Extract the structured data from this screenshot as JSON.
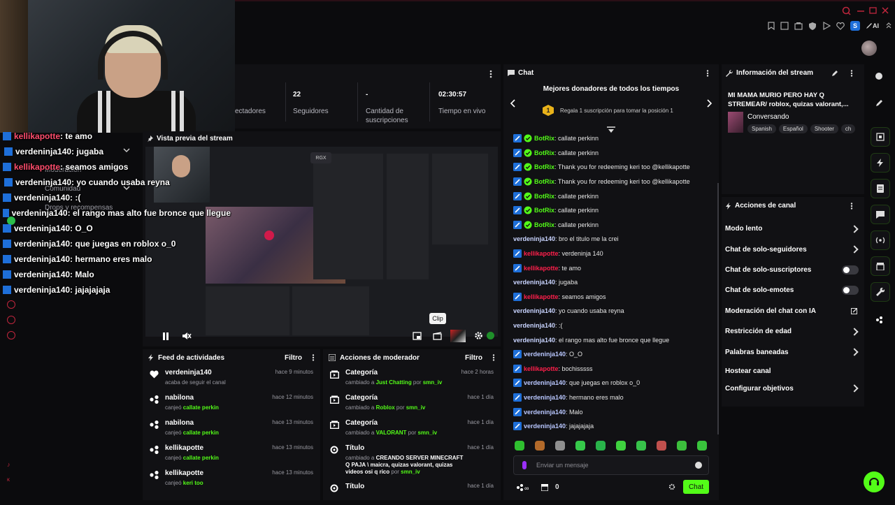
{
  "colors": {
    "accent": "#53fc18",
    "bg": "#0b0b0d",
    "panel": "#111114",
    "mod_badge": "#1e6fd9",
    "red_user": "#ff4d6d"
  },
  "topbar": {
    "ai_label": "AI",
    "avatar_letter": "S"
  },
  "stats": {
    "viewers_label": "ectadores",
    "followers_value": "22",
    "followers_label": "Seguidores",
    "subs_value": "-",
    "subs_label": "Cantidad de suscripciones",
    "uptime_value": "02:30:57",
    "uptime_label": "Tiempo en vivo"
  },
  "preview": {
    "title": "Vista previa del stream",
    "clip_tooltip": "Clip"
  },
  "sidebar_ghost": [
    "Moderación",
    "Comunidad",
    "Drops y recompensas"
  ],
  "overlay_chat": [
    {
      "user": "kellikapotte",
      "text": " : te amo",
      "color": "red"
    },
    {
      "user": "verdeninja140",
      "text": " : jugaba",
      "color": "white"
    },
    {
      "user": "kellikapotte",
      "text": " : seamos amigos",
      "color": "red"
    },
    {
      "user": "verdeninja140",
      "text": " : yo cuando usaba reyna",
      "color": "white"
    },
    {
      "user": "verdeninja140",
      "text": " : :(",
      "color": "white"
    },
    {
      "user": "verdeninja140",
      "text": " : el rango mas alto fue bronce que llegue",
      "color": "white"
    },
    {
      "user": "verdeninja140",
      "text": " : O_O",
      "color": "white"
    },
    {
      "user": "verdeninja140",
      "text": " : que juegas en roblox o_0",
      "color": "white"
    },
    {
      "user": "verdeninja140",
      "text": " : hermano eres malo",
      "color": "white"
    },
    {
      "user": "verdeninja140",
      "text": " : Malo",
      "color": "white"
    },
    {
      "user": "verdeninja140",
      "text": " : jajajajaja",
      "color": "white"
    }
  ],
  "feed": {
    "title": "Feed de actividades",
    "filter": "Filtro",
    "items": [
      {
        "user": "verdeninja140",
        "desc": "acaba de seguir el canal",
        "highlight": "",
        "time": "hace 9 minutos",
        "icon": "heart-icon"
      },
      {
        "user": "nabilona",
        "desc": "canjeó ",
        "highlight": "callate perkin",
        "time": "hace 12 minutos",
        "icon": "reward-icon"
      },
      {
        "user": "nabilona",
        "desc": "canjeó ",
        "highlight": "callate perkin",
        "time": "hace 13 minutos",
        "icon": "reward-icon"
      },
      {
        "user": "kellikapotte",
        "desc": "canjeó ",
        "highlight": "callate perkin",
        "time": "hace 13 minutos",
        "icon": "reward-icon"
      },
      {
        "user": "kellikapotte",
        "desc": "canjeó ",
        "highlight": "keri too",
        "time": "hace 13 minutos",
        "icon": "reward-icon"
      }
    ]
  },
  "modactions": {
    "title": "Acciones de moderador",
    "filter": "Filtro",
    "items": [
      {
        "title": "Categoría",
        "pre": "cambiado a ",
        "value": "Just Chatting",
        "mid": " por ",
        "by": "smn_iv",
        "time": "hace 2 horas"
      },
      {
        "title": "Categoría",
        "pre": "cambiado a ",
        "value": "Roblox",
        "mid": " por ",
        "by": "smn_iv",
        "time": "hace 1 día"
      },
      {
        "title": "Categoría",
        "pre": "cambiado a ",
        "value": "VALORANT",
        "mid": " por ",
        "by": "smn_iv",
        "time": "hace 1 día"
      },
      {
        "title": "Título",
        "pre": "cambiado a ",
        "value": "CREANDO SERVER MINECRAFT Q PAJA \\ maicra, quizas valorant, quizas videos osi q rico",
        "mid": " por ",
        "by": "smn_iv",
        "time": "hace 1 día"
      },
      {
        "title": "Título",
        "pre": "",
        "value": "",
        "mid": "",
        "by": "",
        "time": "hace 1 día"
      }
    ]
  },
  "chat": {
    "title": "Chat",
    "donors_title": "Mejores donadores de todos los tiempos",
    "donors_rank": "1",
    "donors_text": "Regala 1 suscripción para tomar la posición 1",
    "messages": [
      {
        "user": "BotRix",
        "text": ": callate perkinn",
        "style": "bot"
      },
      {
        "user": "BotRix",
        "text": ": callate perkinn",
        "style": "bot"
      },
      {
        "user": "BotRix",
        "text": ": Thank you for redeeming keri too @kellikapotte",
        "style": "bot"
      },
      {
        "user": "BotRix",
        "text": ": Thank you for redeeming keri too @kellikapotte",
        "style": "bot"
      },
      {
        "user": "BotRix",
        "text": ": callate perkinn",
        "style": "bot"
      },
      {
        "user": "BotRix",
        "text": ": callate perkinn",
        "style": "bot"
      },
      {
        "user": "BotRix",
        "text": ": callate perkinn",
        "style": "bot"
      },
      {
        "user": "verdeninja140",
        "text": ": bro el titulo me la crei",
        "style": "plain"
      },
      {
        "user": "kellikapotte",
        "text": ": verdeninja 140",
        "style": "red"
      },
      {
        "user": "kellikapotte",
        "text": ": te amo",
        "style": "red"
      },
      {
        "user": "verdeninja140",
        "text": ": jugaba",
        "style": "plain"
      },
      {
        "user": "kellikapotte",
        "text": ": seamos amigos",
        "style": "red"
      },
      {
        "user": "verdeninja140",
        "text": ": yo cuando usaba reyna",
        "style": "plain"
      },
      {
        "user": "verdeninja140",
        "text": ": :(",
        "style": "plain"
      },
      {
        "user": "verdeninja140",
        "text": ": el rango mas alto fue bronce que llegue",
        "style": "plain"
      },
      {
        "user": "verdeninja140",
        "text": ": O_O",
        "style": "mod"
      },
      {
        "user": "kellikapotte",
        "text": ": bochisssss",
        "style": "red"
      },
      {
        "user": "verdeninja140",
        "text": ": que juegas en roblox o_0",
        "style": "mod"
      },
      {
        "user": "verdeninja140",
        "text": ": hermano eres malo",
        "style": "mod"
      },
      {
        "user": "verdeninja140",
        "text": ": Malo",
        "style": "mod"
      },
      {
        "user": "verdeninja140",
        "text": ": jajajajaja",
        "style": "mod"
      }
    ],
    "input_placeholder": "Enviar un mensaje",
    "points": "0",
    "send_label": "Chat"
  },
  "info": {
    "title": "Información del stream",
    "stream_title": "MI MAMA MURIO PERO HAY Q STREMEAR/ roblox, quizas valorant,...",
    "category": "Conversando",
    "tags": [
      "Spanish",
      "Español",
      "Shooter",
      "ch"
    ]
  },
  "actions": {
    "title": "Acciones de canal",
    "items": [
      {
        "label": "Modo lento",
        "control": "chevron"
      },
      {
        "label": "Chat de solo-seguidores",
        "control": "chevron"
      },
      {
        "label": "Chat de solo-suscriptores",
        "control": "toggle"
      },
      {
        "label": "Chat de solo-emotes",
        "control": "toggle"
      },
      {
        "label": "Moderación del chat con IA",
        "control": "external"
      },
      {
        "label": "Restricción de edad",
        "control": "chevron"
      },
      {
        "label": "Palabras baneadas",
        "control": "chevron"
      },
      {
        "label": "Hostear canal",
        "control": "none"
      },
      {
        "label": "Configurar objetivos",
        "control": "chevron"
      }
    ]
  }
}
